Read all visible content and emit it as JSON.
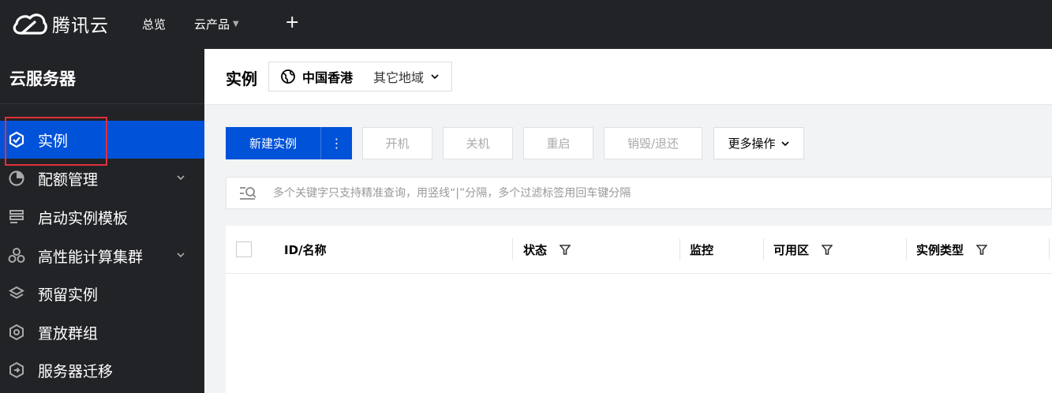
{
  "topbar": {
    "brand": "腾讯云",
    "nav_overview": "总览",
    "nav_products": "云产品",
    "plus": "+"
  },
  "sidebar": {
    "title": "云服务器",
    "items": [
      {
        "label": "实例",
        "icon": "instance-cube-icon",
        "active": true
      },
      {
        "label": "配额管理",
        "icon": "quota-pie-icon",
        "expandable": true
      },
      {
        "label": "启动实例模板",
        "icon": "template-icon"
      },
      {
        "label": "高性能计算集群",
        "icon": "cluster-icon",
        "expandable": true
      },
      {
        "label": "预留实例",
        "icon": "layers-icon"
      },
      {
        "label": "置放群组",
        "icon": "placement-group-icon"
      },
      {
        "label": "服务器迁移",
        "icon": "migration-icon"
      }
    ]
  },
  "header": {
    "title": "实例",
    "region_current": "中国香港",
    "region_other": "其它地域"
  },
  "toolbar": {
    "create": "新建实例",
    "dots": "⋮",
    "power_on": "开机",
    "power_off": "关机",
    "restart": "重启",
    "destroy": "销毁/退还",
    "more": "更多操作"
  },
  "search": {
    "placeholder": "多个关键字只支持精准查询，用竖线“|”分隔，多个过滤标签用回车键分隔"
  },
  "table": {
    "columns": [
      "ID/名称",
      "状态",
      "监控",
      "可用区",
      "实例类型"
    ]
  },
  "colors": {
    "topbar_bg": "#222326",
    "primary": "#0052d9",
    "highlight": "#e0303a"
  }
}
